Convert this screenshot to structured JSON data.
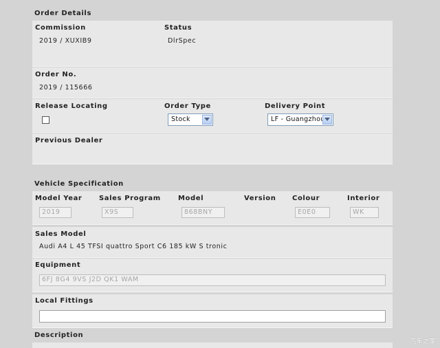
{
  "order_details": {
    "title": "Order Details",
    "commission_label": "Commission",
    "commission_value": "2019 / XUXIB9",
    "status_label": "Status",
    "status_value": "DlrSpec",
    "order_no_label": "Order No.",
    "order_no_value": "2019 / 115666",
    "release_locating_label": "Release Locating",
    "release_locating_checked": false,
    "order_type_label": "Order Type",
    "order_type_value": "Stock",
    "delivery_point_label": "Delivery Point",
    "delivery_point_value": "LF - Guangzhou",
    "previous_dealer_label": "Previous Dealer",
    "previous_dealer_value": ""
  },
  "vehicle_spec": {
    "title": "Vehicle Specification",
    "model_year_label": "Model Year",
    "model_year_value": "2019",
    "sales_program_label": "Sales Program",
    "sales_program_value": "X9S",
    "model_label": "Model",
    "model_value": "868BNY",
    "version_label": "Version",
    "colour_label": "Colour",
    "colour_value": "E0E0",
    "interior_label": "Interior",
    "interior_value": "WK",
    "sales_model_label": "Sales Model",
    "sales_model_value": "Audi A4 L 45 TFSI quattro Sport C6 185 kW S tronic",
    "equipment_label": "Equipment",
    "equipment_value": "6FJ 8G4 9VS J2D QK1 WAM",
    "local_fittings_label": "Local Fittings",
    "local_fittings_value": "",
    "description_label": "Description"
  },
  "watermark": "汽车之家",
  "colors": {
    "page_bg": "#d4d4d4",
    "band_bg": "#e8e8e8",
    "select_border": "#7f9db9"
  }
}
